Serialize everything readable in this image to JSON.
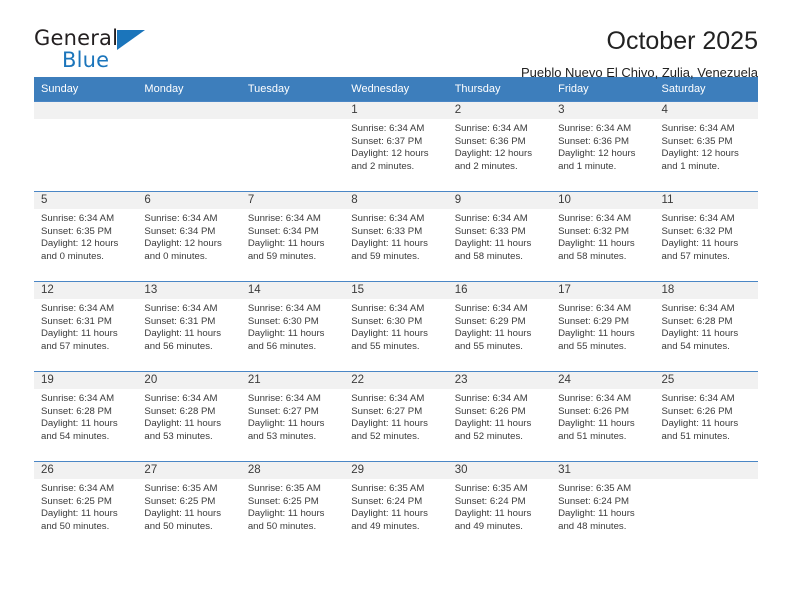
{
  "brand": {
    "name_top": "General",
    "name_bottom": "Blue",
    "triangle_color": "#1b75bb",
    "icon": "triangle-icon"
  },
  "header": {
    "title": "October 2025",
    "subtitle": "Pueblo Nuevo El Chivo, Zulia, Venezuela"
  },
  "theme": {
    "header_blue": "#3d7ebc",
    "row_divider": "#4a86c5",
    "daynum_band": "#f1f1f1",
    "text": "#3b3b3b"
  },
  "weekday_headers": [
    "Sunday",
    "Monday",
    "Tuesday",
    "Wednesday",
    "Thursday",
    "Friday",
    "Saturday"
  ],
  "weeks": [
    [
      {
        "day": "",
        "sunrise": "",
        "sunset": "",
        "daylight_line1": "",
        "daylight_line2": ""
      },
      {
        "day": "",
        "sunrise": "",
        "sunset": "",
        "daylight_line1": "",
        "daylight_line2": ""
      },
      {
        "day": "",
        "sunrise": "",
        "sunset": "",
        "daylight_line1": "",
        "daylight_line2": ""
      },
      {
        "day": "1",
        "sunrise": "Sunrise: 6:34 AM",
        "sunset": "Sunset: 6:37 PM",
        "daylight_line1": "Daylight: 12 hours",
        "daylight_line2": "and 2 minutes."
      },
      {
        "day": "2",
        "sunrise": "Sunrise: 6:34 AM",
        "sunset": "Sunset: 6:36 PM",
        "daylight_line1": "Daylight: 12 hours",
        "daylight_line2": "and 2 minutes."
      },
      {
        "day": "3",
        "sunrise": "Sunrise: 6:34 AM",
        "sunset": "Sunset: 6:36 PM",
        "daylight_line1": "Daylight: 12 hours",
        "daylight_line2": "and 1 minute."
      },
      {
        "day": "4",
        "sunrise": "Sunrise: 6:34 AM",
        "sunset": "Sunset: 6:35 PM",
        "daylight_line1": "Daylight: 12 hours",
        "daylight_line2": "and 1 minute."
      }
    ],
    [
      {
        "day": "5",
        "sunrise": "Sunrise: 6:34 AM",
        "sunset": "Sunset: 6:35 PM",
        "daylight_line1": "Daylight: 12 hours",
        "daylight_line2": "and 0 minutes."
      },
      {
        "day": "6",
        "sunrise": "Sunrise: 6:34 AM",
        "sunset": "Sunset: 6:34 PM",
        "daylight_line1": "Daylight: 12 hours",
        "daylight_line2": "and 0 minutes."
      },
      {
        "day": "7",
        "sunrise": "Sunrise: 6:34 AM",
        "sunset": "Sunset: 6:34 PM",
        "daylight_line1": "Daylight: 11 hours",
        "daylight_line2": "and 59 minutes."
      },
      {
        "day": "8",
        "sunrise": "Sunrise: 6:34 AM",
        "sunset": "Sunset: 6:33 PM",
        "daylight_line1": "Daylight: 11 hours",
        "daylight_line2": "and 59 minutes."
      },
      {
        "day": "9",
        "sunrise": "Sunrise: 6:34 AM",
        "sunset": "Sunset: 6:33 PM",
        "daylight_line1": "Daylight: 11 hours",
        "daylight_line2": "and 58 minutes."
      },
      {
        "day": "10",
        "sunrise": "Sunrise: 6:34 AM",
        "sunset": "Sunset: 6:32 PM",
        "daylight_line1": "Daylight: 11 hours",
        "daylight_line2": "and 58 minutes."
      },
      {
        "day": "11",
        "sunrise": "Sunrise: 6:34 AM",
        "sunset": "Sunset: 6:32 PM",
        "daylight_line1": "Daylight: 11 hours",
        "daylight_line2": "and 57 minutes."
      }
    ],
    [
      {
        "day": "12",
        "sunrise": "Sunrise: 6:34 AM",
        "sunset": "Sunset: 6:31 PM",
        "daylight_line1": "Daylight: 11 hours",
        "daylight_line2": "and 57 minutes."
      },
      {
        "day": "13",
        "sunrise": "Sunrise: 6:34 AM",
        "sunset": "Sunset: 6:31 PM",
        "daylight_line1": "Daylight: 11 hours",
        "daylight_line2": "and 56 minutes."
      },
      {
        "day": "14",
        "sunrise": "Sunrise: 6:34 AM",
        "sunset": "Sunset: 6:30 PM",
        "daylight_line1": "Daylight: 11 hours",
        "daylight_line2": "and 56 minutes."
      },
      {
        "day": "15",
        "sunrise": "Sunrise: 6:34 AM",
        "sunset": "Sunset: 6:30 PM",
        "daylight_line1": "Daylight: 11 hours",
        "daylight_line2": "and 55 minutes."
      },
      {
        "day": "16",
        "sunrise": "Sunrise: 6:34 AM",
        "sunset": "Sunset: 6:29 PM",
        "daylight_line1": "Daylight: 11 hours",
        "daylight_line2": "and 55 minutes."
      },
      {
        "day": "17",
        "sunrise": "Sunrise: 6:34 AM",
        "sunset": "Sunset: 6:29 PM",
        "daylight_line1": "Daylight: 11 hours",
        "daylight_line2": "and 55 minutes."
      },
      {
        "day": "18",
        "sunrise": "Sunrise: 6:34 AM",
        "sunset": "Sunset: 6:28 PM",
        "daylight_line1": "Daylight: 11 hours",
        "daylight_line2": "and 54 minutes."
      }
    ],
    [
      {
        "day": "19",
        "sunrise": "Sunrise: 6:34 AM",
        "sunset": "Sunset: 6:28 PM",
        "daylight_line1": "Daylight: 11 hours",
        "daylight_line2": "and 54 minutes."
      },
      {
        "day": "20",
        "sunrise": "Sunrise: 6:34 AM",
        "sunset": "Sunset: 6:28 PM",
        "daylight_line1": "Daylight: 11 hours",
        "daylight_line2": "and 53 minutes."
      },
      {
        "day": "21",
        "sunrise": "Sunrise: 6:34 AM",
        "sunset": "Sunset: 6:27 PM",
        "daylight_line1": "Daylight: 11 hours",
        "daylight_line2": "and 53 minutes."
      },
      {
        "day": "22",
        "sunrise": "Sunrise: 6:34 AM",
        "sunset": "Sunset: 6:27 PM",
        "daylight_line1": "Daylight: 11 hours",
        "daylight_line2": "and 52 minutes."
      },
      {
        "day": "23",
        "sunrise": "Sunrise: 6:34 AM",
        "sunset": "Sunset: 6:26 PM",
        "daylight_line1": "Daylight: 11 hours",
        "daylight_line2": "and 52 minutes."
      },
      {
        "day": "24",
        "sunrise": "Sunrise: 6:34 AM",
        "sunset": "Sunset: 6:26 PM",
        "daylight_line1": "Daylight: 11 hours",
        "daylight_line2": "and 51 minutes."
      },
      {
        "day": "25",
        "sunrise": "Sunrise: 6:34 AM",
        "sunset": "Sunset: 6:26 PM",
        "daylight_line1": "Daylight: 11 hours",
        "daylight_line2": "and 51 minutes."
      }
    ],
    [
      {
        "day": "26",
        "sunrise": "Sunrise: 6:34 AM",
        "sunset": "Sunset: 6:25 PM",
        "daylight_line1": "Daylight: 11 hours",
        "daylight_line2": "and 50 minutes."
      },
      {
        "day": "27",
        "sunrise": "Sunrise: 6:35 AM",
        "sunset": "Sunset: 6:25 PM",
        "daylight_line1": "Daylight: 11 hours",
        "daylight_line2": "and 50 minutes."
      },
      {
        "day": "28",
        "sunrise": "Sunrise: 6:35 AM",
        "sunset": "Sunset: 6:25 PM",
        "daylight_line1": "Daylight: 11 hours",
        "daylight_line2": "and 50 minutes."
      },
      {
        "day": "29",
        "sunrise": "Sunrise: 6:35 AM",
        "sunset": "Sunset: 6:24 PM",
        "daylight_line1": "Daylight: 11 hours",
        "daylight_line2": "and 49 minutes."
      },
      {
        "day": "30",
        "sunrise": "Sunrise: 6:35 AM",
        "sunset": "Sunset: 6:24 PM",
        "daylight_line1": "Daylight: 11 hours",
        "daylight_line2": "and 49 minutes."
      },
      {
        "day": "31",
        "sunrise": "Sunrise: 6:35 AM",
        "sunset": "Sunset: 6:24 PM",
        "daylight_line1": "Daylight: 11 hours",
        "daylight_line2": "and 48 minutes."
      },
      {
        "day": "",
        "sunrise": "",
        "sunset": "",
        "daylight_line1": "",
        "daylight_line2": ""
      }
    ]
  ]
}
